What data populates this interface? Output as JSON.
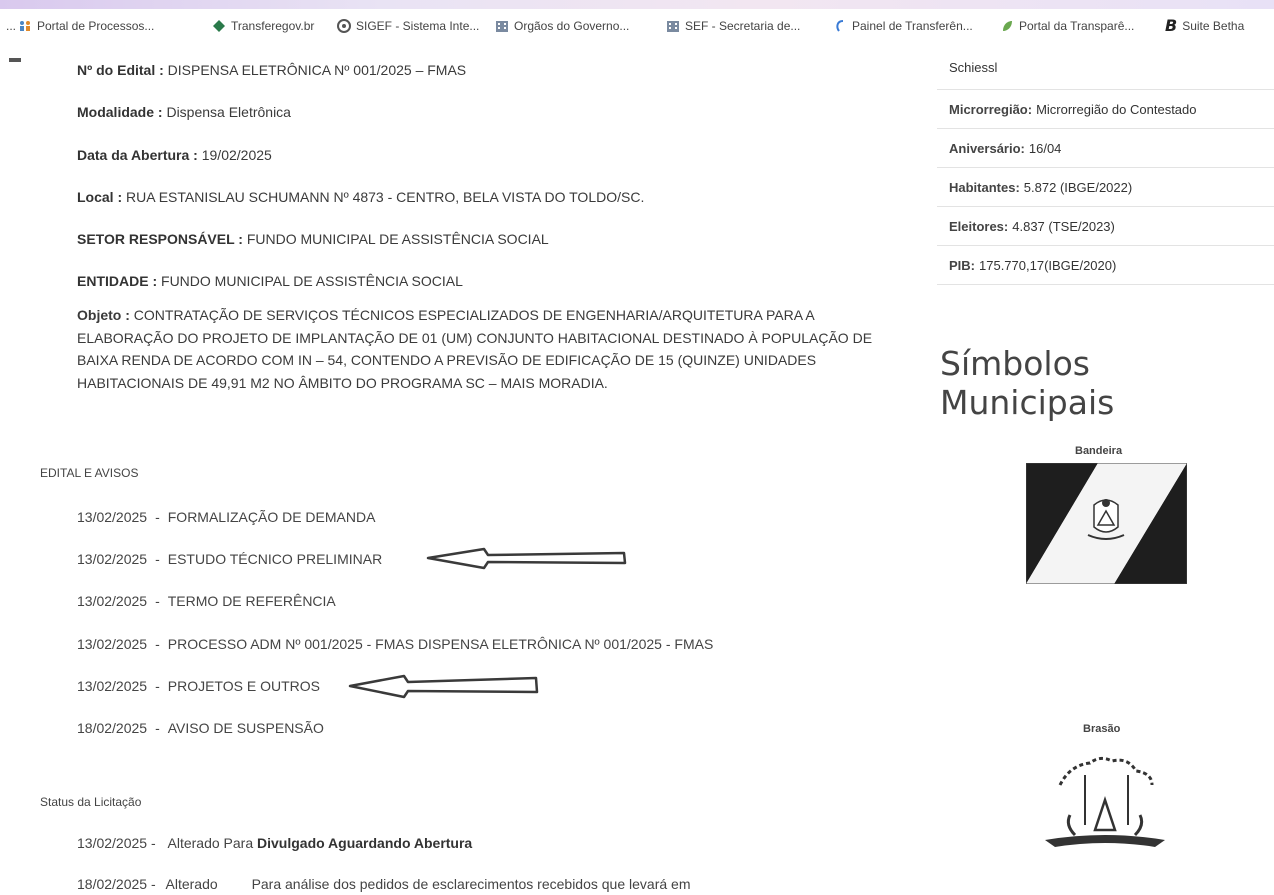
{
  "bookmarks": [
    {
      "label": "Portal de Processos...",
      "icon": "people-icon"
    },
    {
      "label": "Transferegov.br",
      "icon": "diamond-icon"
    },
    {
      "label": "SIGEF - Sistema Inte...",
      "icon": "gear-circle-icon"
    },
    {
      "label": "Orgãos do Governo...",
      "icon": "building-icon"
    },
    {
      "label": "SEF - Secretaria de...",
      "icon": "building-icon"
    },
    {
      "label": "Painel de Transferên...",
      "icon": "hook-icon"
    },
    {
      "label": "Portal da Transparê...",
      "icon": "leaf-icon"
    },
    {
      "label": "Suite Betha",
      "icon": "betha-b-icon",
      "glyph": "B"
    }
  ],
  "overflow": "...",
  "details": {
    "edital_label": "Nº do Edital :",
    "edital_value": "DISPENSA ELETRÔNICA Nº 001/2025 – FMAS",
    "modalidade_label": "Modalidade :",
    "modalidade_value": "Dispensa Eletrônica",
    "abertura_label": "Data da Abertura :",
    "abertura_value": "19/02/2025",
    "local_label": "Local :",
    "local_value": "RUA ESTANISLAU SCHUMANN Nº 4873 - CENTRO, BELA VISTA DO TOLDO/SC.",
    "setor_label": "SETOR RESPONSÁVEL :",
    "setor_value": "FUNDO MUNICIPAL DE ASSISTÊNCIA SOCIAL",
    "entidade_label": "ENTIDADE :",
    "entidade_value": "FUNDO MUNICIPAL DE ASSISTÊNCIA SOCIAL",
    "objeto_label": "Objeto :",
    "objeto_value": "CONTRATAÇÃO DE SERVIÇOS TÉCNICOS ESPECIALIZADOS DE ENGENHARIA/ARQUITETURA PARA A ELABORAÇÃO DO PROJETO DE IMPLANTAÇÃO DE 01 (UM) CONJUNTO HABITACIONAL DESTINADO À POPULAÇÃO DE BAIXA RENDA DE ACORDO COM IN – 54, CONTENDO A PREVISÃO DE EDIFICAÇÃO DE 15 (QUINZE) UNIDADES HABITACIONAIS DE 49,91 M2 NO ÂMBITO DO PROGRAMA SC – MAIS MORADIA."
  },
  "edital_section": {
    "title": "EDITAL E AVISOS",
    "separator": "-",
    "items": [
      {
        "date": "13/02/2025",
        "label": "FORMALIZAÇÃO DE DEMANDA"
      },
      {
        "date": "13/02/2025",
        "label": "ESTUDO TÉCNICO PRELIMINAR"
      },
      {
        "date": "13/02/2025",
        "label": "TERMO DE REFERÊNCIA"
      },
      {
        "date": "13/02/2025",
        "label": "PROCESSO ADM Nº 001/2025 - FMAS DISPENSA ELETRÔNICA Nº 001/2025 - FMAS"
      },
      {
        "date": "13/02/2025",
        "label": "PROJETOS E OUTROS"
      },
      {
        "date": "18/02/2025",
        "label": "AVISO DE SUSPENSÃO"
      }
    ]
  },
  "status_section": {
    "title": "Status da Licitação",
    "items": [
      {
        "date": "13/02/2025 -",
        "action": "Alterado Para",
        "status": "Divulgado Aguardando Abertura"
      },
      {
        "date": "18/02/2025 -",
        "action": "Alterado",
        "status": "Para análise dos pedidos de esclarecimentos recebidos que levará em"
      }
    ]
  },
  "city_info": {
    "name_cut": "Schiessl",
    "rows": [
      {
        "label": "Microrregião:",
        "value": "Microrregião do Contestado"
      },
      {
        "label": "Aniversário:",
        "value": "16/04"
      },
      {
        "label": "Habitantes:",
        "value": "5.872 (IBGE/2022)"
      },
      {
        "label": "Eleitores:",
        "value": "4.837 (TSE/2023)"
      },
      {
        "label": "PIB:",
        "value": "175.770,17(IBGE/2020)"
      }
    ]
  },
  "symbols": {
    "title": "Símbolos Municipais",
    "flag_label": "Bandeira",
    "coat_label": "Brasão"
  }
}
